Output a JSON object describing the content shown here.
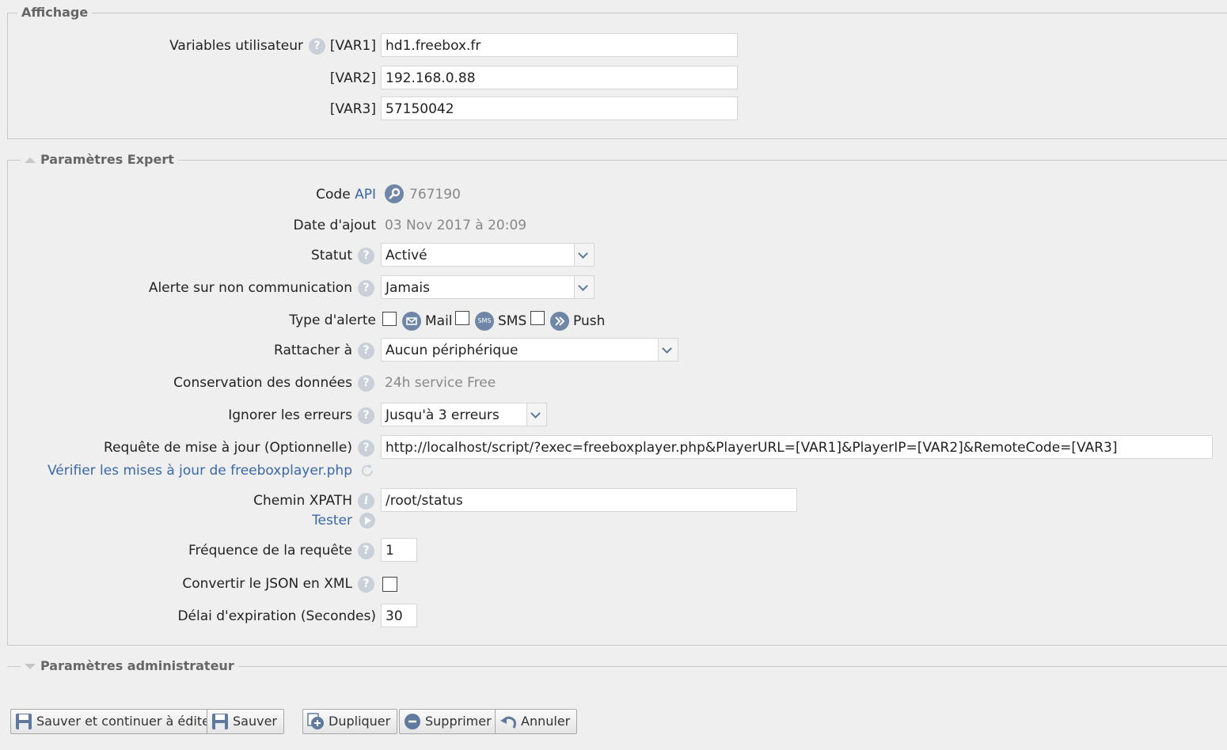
{
  "affichage": {
    "legend": "Affichage",
    "user_vars_label": "Variables utilisateur",
    "vars": [
      {
        "label": "[VAR1]",
        "value": "hd1.freebox.fr"
      },
      {
        "label": "[VAR2]",
        "value": "192.168.0.88"
      },
      {
        "label": "[VAR3]",
        "value": "57150042"
      }
    ]
  },
  "expert": {
    "legend": "Paramètres Expert",
    "code_label": "Code",
    "code_link": "API",
    "code_value": "767190",
    "date_label": "Date d'ajout",
    "date_value": "03 Nov 2017 à 20:09",
    "statut_label": "Statut",
    "statut_value": "Activé",
    "alerte_label": "Alerte sur non communication",
    "alerte_value": "Jamais",
    "type_alerte_label": "Type d'alerte",
    "type_mail": "Mail",
    "type_sms": "SMS",
    "type_push": "Push",
    "sms_icon_text": "SMS",
    "rattacher_label": "Rattacher à",
    "rattacher_value": "Aucun périphérique",
    "conservation_label": "Conservation des données",
    "conservation_value": "24h service Free",
    "ignorer_label": "Ignorer les erreurs",
    "ignorer_value": "Jusqu'à 3 erreurs",
    "requete_label": "Requête de mise à jour (Optionnelle)",
    "requete_value": "http://localhost/script/?exec=freeboxplayer.php&PlayerURL=[VAR1]&PlayerIP=[VAR2]&RemoteCode=[VAR3]",
    "verifier_link": "Vérifier les mises à jour de freeboxplayer.php",
    "xpath_label": "Chemin XPATH",
    "xpath_value": "/root/status",
    "tester_link": "Tester",
    "frequence_label": "Fréquence de la requête",
    "frequence_value": "1",
    "json_label": "Convertir le JSON en XML",
    "delai_label": "Délai d'expiration (Secondes)",
    "delai_value": "30"
  },
  "admin": {
    "legend": "Paramètres administrateur"
  },
  "buttons": {
    "save_continue": "Sauver et continuer à éditer",
    "save": "Sauver",
    "duplicate": "Dupliquer",
    "delete": "Supprimer",
    "cancel": "Annuler"
  },
  "colors": {
    "background": "#efefef",
    "link": "#3a68a8",
    "help_icon": "#c9d0d8",
    "icon_blue": "#6f86a6"
  }
}
